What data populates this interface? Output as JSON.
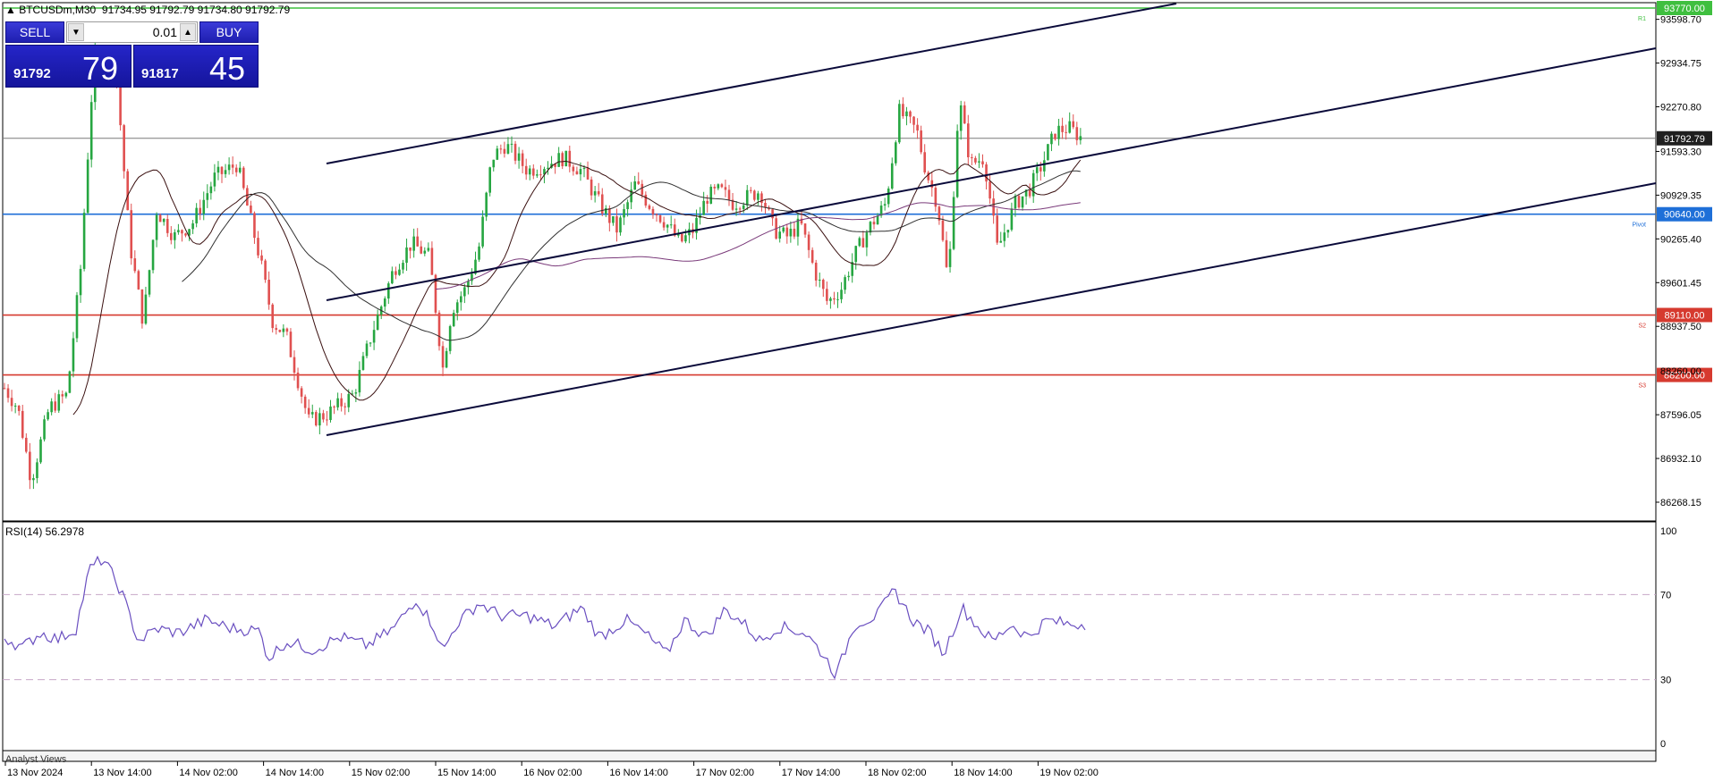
{
  "header": {
    "symbol": "BTCUSDm,M30",
    "ohlc": "91734.95 91792.79 91734.80 91792.79"
  },
  "trade_panel": {
    "sell_label": "SELL",
    "buy_label": "BUY",
    "lot": "0.01",
    "sell_price_main": "91792",
    "sell_price_big": "79",
    "buy_price_main": "91817",
    "buy_price_big": "45"
  },
  "price_axis": {
    "labels": [
      "93598.70",
      "92934.75",
      "92270.80",
      "91593.30",
      "90929.35",
      "90265.40",
      "89601.45",
      "88937.50",
      "87596.05",
      "86932.10",
      "86268.15"
    ],
    "partially_hidden_label": "88260.00"
  },
  "levels": [
    {
      "value": "93770.00",
      "color": "#3fbf3f",
      "tag": "R1"
    },
    {
      "value": "91792.79",
      "color": "#7a7a7a",
      "tag": ""
    },
    {
      "value": "90640.00",
      "color": "#1e6fd8",
      "tag": "Pivot"
    },
    {
      "value": "89110.00",
      "color": "#d63a2f",
      "tag": "S2"
    },
    {
      "value": "88200.00",
      "color": "#d63a2f",
      "tag": "S3"
    }
  ],
  "time_axis": {
    "labels": [
      "13 Nov 2024",
      "13 Nov 14:00",
      "14 Nov 02:00",
      "14 Nov 14:00",
      "15 Nov 02:00",
      "15 Nov 14:00",
      "16 Nov 02:00",
      "16 Nov 14:00",
      "17 Nov 02:00",
      "17 Nov 14:00",
      "18 Nov 02:00",
      "18 Nov 14:00",
      "19 Nov 02:00"
    ]
  },
  "rsi": {
    "label": "RSI(14) 56.2978",
    "axis_labels": [
      "100",
      "70",
      "30",
      "0"
    ]
  },
  "bottom_tab": "Analyst Views",
  "colors": {
    "bull": "#26a641",
    "bear": "#e05050",
    "channel": "#0a0a3a",
    "ma_dark": "#3a1010",
    "ma_gray": "#303030",
    "ma_purple": "#7a3a7a",
    "rsi_line": "#6a4fc0"
  }
}
